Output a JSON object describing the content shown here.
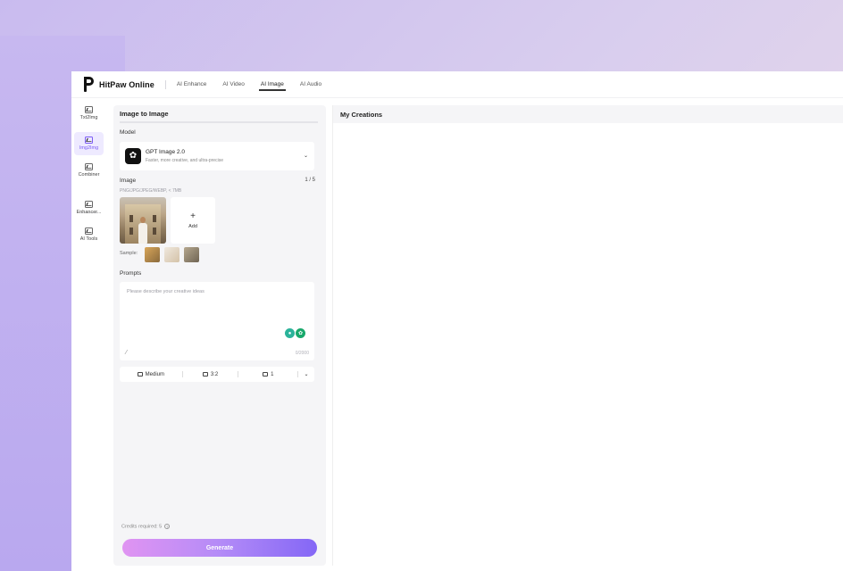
{
  "brand": {
    "name": "HitPaw Online"
  },
  "nav": [
    "AI Enhance",
    "AI Video",
    "AI Image",
    "AI Audio"
  ],
  "nav_active": "AI Image",
  "rail": [
    "Txt2Img",
    "Img2Img",
    "Combiner",
    "Enhancer...",
    "AI Tools"
  ],
  "rail_active": "Img2Img",
  "panel": {
    "title": "Image to Image",
    "model_label": "Model",
    "model_name": "GPT Image 2.0",
    "model_desc": "Faster, more creative, and ultra-precise",
    "image_label": "Image",
    "image_count": "1 / 5",
    "formats": "PNG/JPG/JPEG/WEBP, < 7MB",
    "add_label": "Add",
    "sample_label": "Sample:",
    "prompts_label": "Prompts",
    "prompt_placeholder": "Please describe your creative ideas",
    "prompt_count": "0/2000",
    "quality": "Medium",
    "ratio": "3:2",
    "num": "1",
    "credits": "Credits required: 5",
    "generate": "Generate"
  },
  "creations": {
    "title": "My Creations"
  },
  "colors": {
    "accent": "#7b5cf5",
    "generate_start": "#e094f2",
    "generate_end": "#8467f6"
  }
}
